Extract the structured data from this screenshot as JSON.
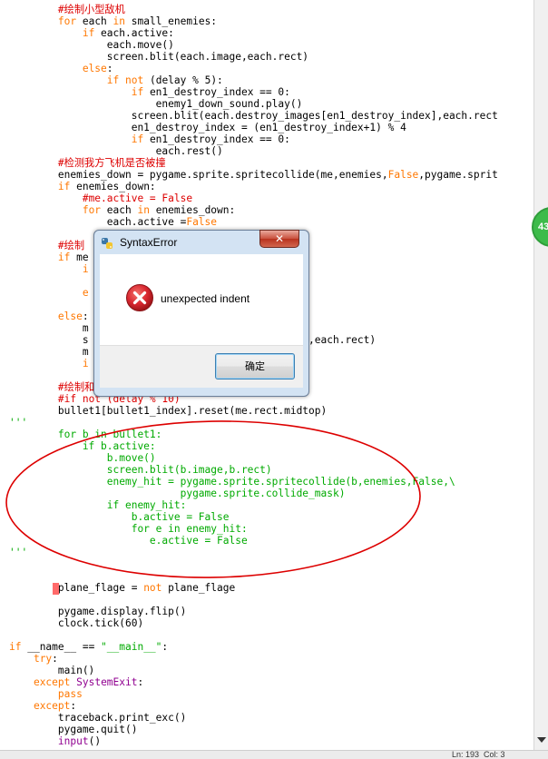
{
  "editor": {
    "lines": [
      [
        {
          "t": "        "
        },
        {
          "t": "#绘制小型敌机",
          "c": "cm"
        }
      ],
      [
        {
          "t": "        "
        },
        {
          "t": "for",
          "c": "kw"
        },
        {
          "t": " each "
        },
        {
          "t": "in",
          "c": "kw"
        },
        {
          "t": " small_enemies:"
        }
      ],
      [
        {
          "t": "            "
        },
        {
          "t": "if",
          "c": "kw"
        },
        {
          "t": " each.active:"
        }
      ],
      [
        {
          "t": "                each.move()"
        }
      ],
      [
        {
          "t": "                screen.blit(each.image,each.rect)"
        }
      ],
      [
        {
          "t": "            "
        },
        {
          "t": "else",
          "c": "kw"
        },
        {
          "t": ":"
        }
      ],
      [
        {
          "t": "                "
        },
        {
          "t": "if",
          "c": "kw"
        },
        {
          "t": " "
        },
        {
          "t": "not",
          "c": "kw"
        },
        {
          "t": " (delay % 5):"
        }
      ],
      [
        {
          "t": "                    "
        },
        {
          "t": "if",
          "c": "kw"
        },
        {
          "t": " en1_destroy_index == 0:"
        }
      ],
      [
        {
          "t": "                        enemy1_down_sound.play()"
        }
      ],
      [
        {
          "t": "                    screen.blit(each.destroy_images[en1_destroy_index],each.rect"
        }
      ],
      [
        {
          "t": "                    en1_destroy_index = (en1_destroy_index+1) % 4"
        }
      ],
      [
        {
          "t": "                    "
        },
        {
          "t": "if",
          "c": "kw"
        },
        {
          "t": " en1_destroy_index == 0:"
        }
      ],
      [
        {
          "t": "                        each.rest()"
        }
      ],
      [
        {
          "t": "        "
        },
        {
          "t": "#检测我方飞机是否被撞",
          "c": "cm"
        }
      ],
      [
        {
          "t": "        enemies_down = pygame.sprite.spritecollide(me,enemies,"
        },
        {
          "t": "False",
          "c": "kw"
        },
        {
          "t": ",pygame.sprit"
        }
      ],
      [
        {
          "t": "        "
        },
        {
          "t": "if",
          "c": "kw"
        },
        {
          "t": " enemies_down:"
        }
      ],
      [
        {
          "t": "            "
        },
        {
          "t": "#me.active = False",
          "c": "cm"
        }
      ],
      [
        {
          "t": "            "
        },
        {
          "t": "for",
          "c": "kw"
        },
        {
          "t": " each "
        },
        {
          "t": "in",
          "c": "kw"
        },
        {
          "t": " enemies_down:"
        }
      ],
      [
        {
          "t": "                each.active ="
        },
        {
          "t": "False",
          "c": "kw"
        }
      ],
      [
        {
          "t": ""
        }
      ],
      [
        {
          "t": "        "
        },
        {
          "t": "#绘制",
          "c": "cm"
        }
      ],
      [
        {
          "t": "        "
        },
        {
          "t": "if",
          "c": "kw"
        },
        {
          "t": " me"
        }
      ],
      [
        {
          "t": "            "
        },
        {
          "t": "i",
          "c": "kw"
        }
      ],
      [
        {
          "t": ""
        }
      ],
      [
        {
          "t": "            "
        },
        {
          "t": "e",
          "c": "kw"
        }
      ],
      [
        {
          "t": ""
        }
      ],
      [
        {
          "t": "        "
        },
        {
          "t": "else",
          "c": "kw"
        },
        {
          "t": ":"
        }
      ],
      [
        {
          "t": "            m"
        }
      ],
      [
        {
          "t": "            s                        stroy_index],each.rect)"
        }
      ],
      [
        {
          "t": "            m                        x+1) % 4"
        }
      ],
      [
        {
          "t": "            "
        },
        {
          "t": "i",
          "c": "kw"
        }
      ],
      [
        {
          "t": ""
        }
      ],
      [
        {
          "t": "        "
        },
        {
          "t": "#绘制和移动子弹相关",
          "c": "cm"
        }
      ],
      [
        {
          "t": "        "
        },
        {
          "t": "#if not (delay % 10)",
          "c": "cm"
        }
      ],
      [
        {
          "t": "        bullet1[bullet1_index].reset(me.rect.midtop)"
        }
      ],
      [
        {
          "t": "'''",
          "c": "str"
        }
      ],
      [
        {
          "t": "        for b in bullet1:",
          "c": "str"
        }
      ],
      [
        {
          "t": "            if b.active:",
          "c": "str"
        }
      ],
      [
        {
          "t": "                b.move()",
          "c": "str"
        }
      ],
      [
        {
          "t": "                screen.blit(b.image,b.rect)",
          "c": "str"
        }
      ],
      [
        {
          "t": "                enemy_hit = pygame.sprite.spritecollide(b,enemies,False,\\",
          "c": "str"
        }
      ],
      [
        {
          "t": "                            pygame.sprite.collide_mask)",
          "c": "str"
        }
      ],
      [
        {
          "t": "                if enemy_hit:",
          "c": "str"
        }
      ],
      [
        {
          "t": "                    b.active = False",
          "c": "str"
        }
      ],
      [
        {
          "t": "                    for e in enemy_hit:",
          "c": "str"
        }
      ],
      [
        {
          "t": "                       e.active = False",
          "c": "str"
        }
      ],
      [
        {
          "t": "'''",
          "c": "str"
        }
      ],
      [
        {
          "t": ""
        }
      ],
      [
        {
          "t": ""
        }
      ],
      [
        {
          "t": "        plane_flage = "
        },
        {
          "t": "not",
          "c": "kw"
        },
        {
          "t": " plane_flage"
        }
      ],
      [
        {
          "t": ""
        }
      ],
      [
        {
          "t": "        pygame.display.flip()"
        }
      ],
      [
        {
          "t": "        clock.tick(60)"
        }
      ],
      [
        {
          "t": ""
        }
      ],
      [
        {
          "t": "if",
          "c": "kw"
        },
        {
          "t": " __name__ == "
        },
        {
          "t": "\"__main__\"",
          "c": "str"
        },
        {
          "t": ":"
        }
      ],
      [
        {
          "t": "    "
        },
        {
          "t": "try",
          "c": "kw"
        },
        {
          "t": ":"
        }
      ],
      [
        {
          "t": "        main()"
        }
      ],
      [
        {
          "t": "    "
        },
        {
          "t": "except",
          "c": "kw"
        },
        {
          "t": " "
        },
        {
          "t": "SystemExit",
          "c": "cls"
        },
        {
          "t": ":"
        }
      ],
      [
        {
          "t": "        "
        },
        {
          "t": "pass",
          "c": "kw"
        }
      ],
      [
        {
          "t": "    "
        },
        {
          "t": "except",
          "c": "kw"
        },
        {
          "t": ":"
        }
      ],
      [
        {
          "t": "        traceback.print_exc()"
        }
      ],
      [
        {
          "t": "        pygame.quit()"
        }
      ],
      [
        {
          "t": "        "
        },
        {
          "t": "input",
          "c": "cls"
        },
        {
          "t": "()"
        }
      ]
    ]
  },
  "dialog": {
    "title": "SyntaxError",
    "message": "unexpected indent",
    "ok_label": "确定",
    "close_glyph": "✕",
    "icon": "error-icon",
    "app_icon": "python-icon"
  },
  "badge": {
    "text": "43"
  },
  "statusbar": {
    "text": "Ln: 193  Col: 3"
  },
  "colors": {
    "keyword": "#ff7700",
    "comment": "#dd0000",
    "string": "#00aa00",
    "builtin": "#900090",
    "annotation": "#dd0000",
    "error": "#d8262f",
    "dialog_frame": "#d3e3f3"
  }
}
